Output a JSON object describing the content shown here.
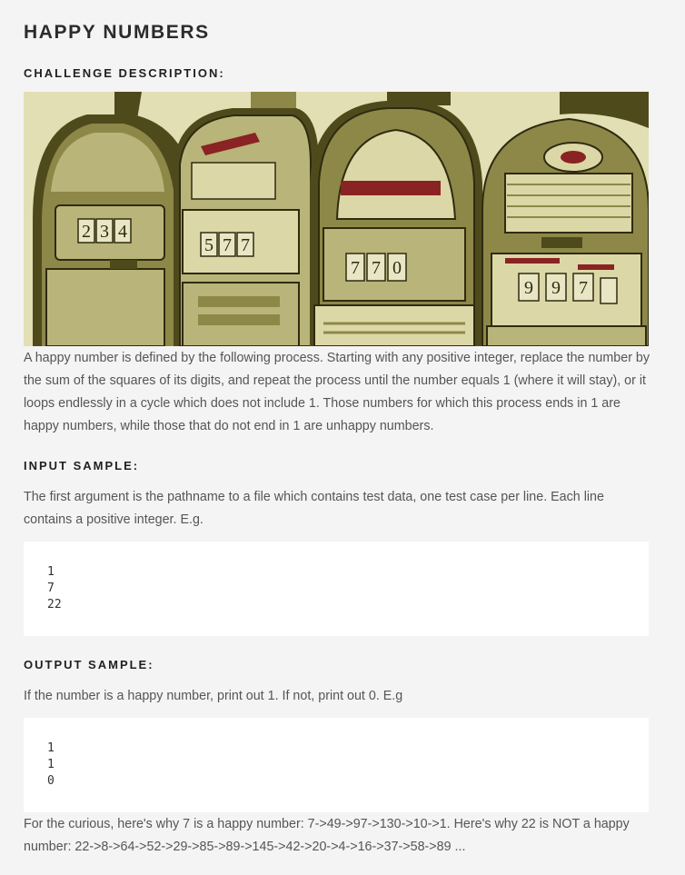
{
  "page": {
    "title": "HAPPY NUMBERS",
    "challenge_heading": "CHALLENGE DESCRIPTION:",
    "description": "A happy number is defined by the following process. Starting with any positive integer, replace the number by the sum of the squares of its digits, and repeat the process until the number equals 1 (where it will stay), or it loops endlessly in a cycle which does not include 1. Those numbers for which this process ends in 1 are happy numbers, while those that do not end in 1 are unhappy numbers.",
    "input_heading": "INPUT SAMPLE:",
    "input_text": "The first argument is the pathname to a file which contains test data, one test case per line. Each line contains a positive integer. E.g.",
    "input_lines": [
      "1",
      "7",
      "22"
    ],
    "output_heading": "OUTPUT SAMPLE:",
    "output_text": "If the number is a happy number, print out 1. If not, print out 0. E.g",
    "output_lines": [
      "1",
      "1",
      "0"
    ],
    "footer_text": "For the curious, here's why 7 is a happy number: 7->49->97->130->10->1. Here's why 22 is NOT a happy number: 22->8->64->52->29->85->89->145->42->20->4->16->37->58->89 ..."
  },
  "illustration": {
    "machine_numbers": [
      [
        "2",
        "3",
        "4"
      ],
      [
        "5",
        "7",
        "7"
      ],
      [
        "7",
        "7",
        "0"
      ],
      [
        "9",
        "9",
        "7"
      ]
    ],
    "colors": {
      "background": "#e3dfb4",
      "dark": "#4f4a1c",
      "mid": "#8d8848",
      "light": "#b9b479",
      "pale": "#dcd7a6",
      "red": "#8a2323"
    }
  }
}
